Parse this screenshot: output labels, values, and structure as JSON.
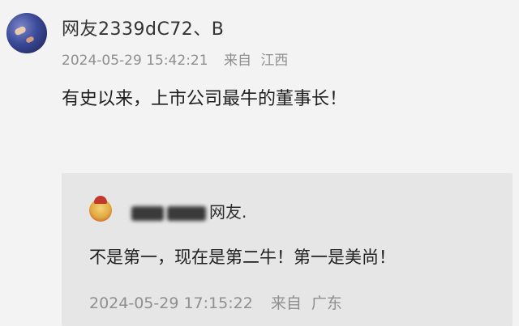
{
  "post": {
    "username": "网友2339dC72、B",
    "timestamp": "2024-05-29 15:42:21",
    "from_label": "来自",
    "location": "江西",
    "comment": "有史以来，上市公司最牛的董事长！"
  },
  "reply": {
    "username_suffix": "网友.",
    "text": "不是第一，现在是第二牛！第一是美尚！",
    "timestamp": "2024-05-29 17:15:22",
    "from_label": "来自",
    "location": "广东"
  }
}
